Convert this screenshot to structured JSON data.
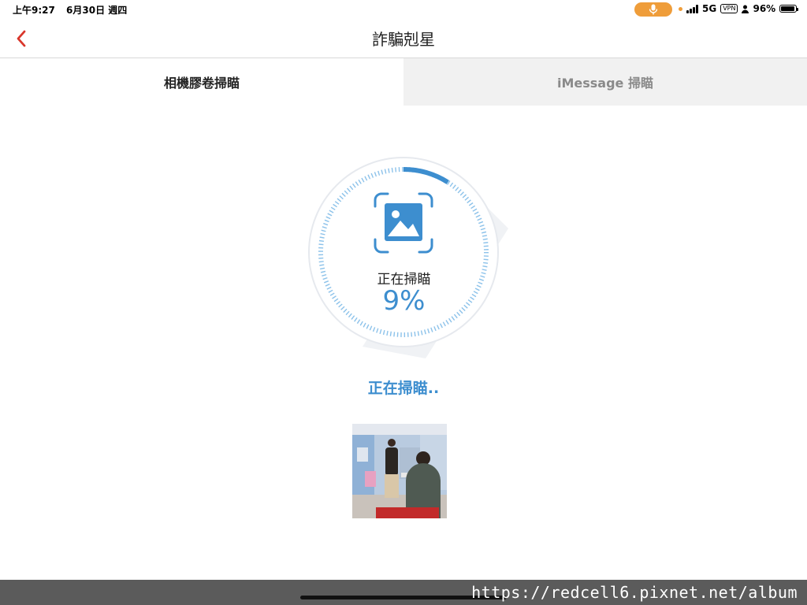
{
  "status_bar": {
    "time": "上午9:27",
    "date": "6月30日 週四",
    "network": "5G",
    "vpn": "VPN",
    "battery": "96%",
    "battery_level": 0.96,
    "colors": {
      "mic_pill": "#ef9d3a"
    }
  },
  "nav": {
    "title": "詐騙剋星",
    "back_icon": "chevron-left-icon",
    "colors": {
      "back": "#d9362b"
    }
  },
  "tabs": [
    {
      "label": "相機膠卷掃瞄",
      "active": true
    },
    {
      "label": "iMessage 掃瞄",
      "active": false
    }
  ],
  "scan": {
    "label": "正在掃瞄",
    "percent_text": "9%",
    "progress": 0.09,
    "status": "正在掃瞄..",
    "icon": "image-scan-icon",
    "colors": {
      "accent": "#3d8ecf"
    }
  },
  "watermark": "https://redcell6.pixnet.net/album"
}
